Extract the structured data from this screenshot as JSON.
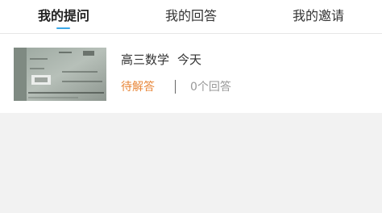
{
  "tabs": [
    {
      "label": "我的提问",
      "active": true
    },
    {
      "label": "我的回答",
      "active": false
    },
    {
      "label": "我的邀请",
      "active": false
    }
  ],
  "colors": {
    "accent": "#3aa7e6",
    "status_orange": "#e8873a",
    "muted_text": "#999999",
    "page_bg": "#f2f2f2"
  },
  "question": {
    "thumbnail_icon": "math-problem-photo",
    "subject": "高三数学",
    "time": "今天",
    "status": "待解答",
    "answer_count": "0个回答"
  }
}
